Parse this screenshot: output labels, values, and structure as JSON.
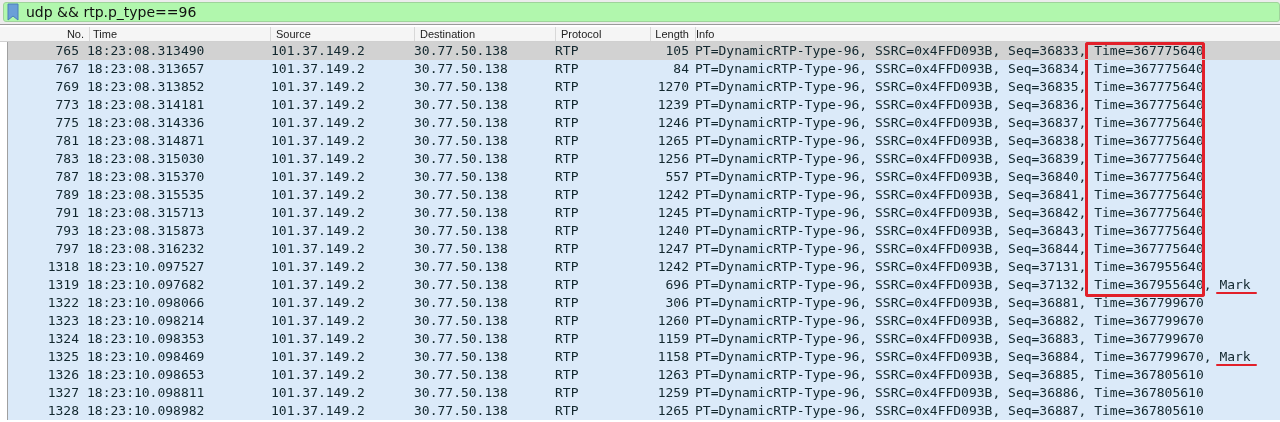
{
  "filter": {
    "value": "udp && rtp.p_type==96"
  },
  "columns": [
    "No.",
    "Time",
    "Source",
    "Destination",
    "Protocol",
    "Length",
    "Info"
  ],
  "rows": [
    {
      "no": "765",
      "time": "18:23:08.313490",
      "source": "101.37.149.2",
      "destination": "30.77.50.138",
      "protocol": "RTP",
      "length": "105",
      "info": "PT=DynamicRTP-Type-96, SSRC=0x4FFD093B, Seq=36833, Time=367775640",
      "selected": true,
      "boxed": true,
      "underlined": false
    },
    {
      "no": "767",
      "time": "18:23:08.313657",
      "source": "101.37.149.2",
      "destination": "30.77.50.138",
      "protocol": "RTP",
      "length": "84",
      "info": "PT=DynamicRTP-Type-96, SSRC=0x4FFD093B, Seq=36834, Time=367775640",
      "selected": false,
      "boxed": true,
      "underlined": false
    },
    {
      "no": "769",
      "time": "18:23:08.313852",
      "source": "101.37.149.2",
      "destination": "30.77.50.138",
      "protocol": "RTP",
      "length": "1270",
      "info": "PT=DynamicRTP-Type-96, SSRC=0x4FFD093B, Seq=36835, Time=367775640",
      "selected": false,
      "boxed": true,
      "underlined": false
    },
    {
      "no": "773",
      "time": "18:23:08.314181",
      "source": "101.37.149.2",
      "destination": "30.77.50.138",
      "protocol": "RTP",
      "length": "1239",
      "info": "PT=DynamicRTP-Type-96, SSRC=0x4FFD093B, Seq=36836, Time=367775640",
      "selected": false,
      "boxed": true,
      "underlined": false
    },
    {
      "no": "775",
      "time": "18:23:08.314336",
      "source": "101.37.149.2",
      "destination": "30.77.50.138",
      "protocol": "RTP",
      "length": "1246",
      "info": "PT=DynamicRTP-Type-96, SSRC=0x4FFD093B, Seq=36837, Time=367775640",
      "selected": false,
      "boxed": true,
      "underlined": false
    },
    {
      "no": "781",
      "time": "18:23:08.314871",
      "source": "101.37.149.2",
      "destination": "30.77.50.138",
      "protocol": "RTP",
      "length": "1265",
      "info": "PT=DynamicRTP-Type-96, SSRC=0x4FFD093B, Seq=36838, Time=367775640",
      "selected": false,
      "boxed": true,
      "underlined": false
    },
    {
      "no": "783",
      "time": "18:23:08.315030",
      "source": "101.37.149.2",
      "destination": "30.77.50.138",
      "protocol": "RTP",
      "length": "1256",
      "info": "PT=DynamicRTP-Type-96, SSRC=0x4FFD093B, Seq=36839, Time=367775640",
      "selected": false,
      "boxed": true,
      "underlined": false
    },
    {
      "no": "787",
      "time": "18:23:08.315370",
      "source": "101.37.149.2",
      "destination": "30.77.50.138",
      "protocol": "RTP",
      "length": "557",
      "info": "PT=DynamicRTP-Type-96, SSRC=0x4FFD093B, Seq=36840, Time=367775640",
      "selected": false,
      "boxed": true,
      "underlined": false
    },
    {
      "no": "789",
      "time": "18:23:08.315535",
      "source": "101.37.149.2",
      "destination": "30.77.50.138",
      "protocol": "RTP",
      "length": "1242",
      "info": "PT=DynamicRTP-Type-96, SSRC=0x4FFD093B, Seq=36841, Time=367775640",
      "selected": false,
      "boxed": true,
      "underlined": false
    },
    {
      "no": "791",
      "time": "18:23:08.315713",
      "source": "101.37.149.2",
      "destination": "30.77.50.138",
      "protocol": "RTP",
      "length": "1245",
      "info": "PT=DynamicRTP-Type-96, SSRC=0x4FFD093B, Seq=36842, Time=367775640",
      "selected": false,
      "boxed": true,
      "underlined": false
    },
    {
      "no": "793",
      "time": "18:23:08.315873",
      "source": "101.37.149.2",
      "destination": "30.77.50.138",
      "protocol": "RTP",
      "length": "1240",
      "info": "PT=DynamicRTP-Type-96, SSRC=0x4FFD093B, Seq=36843, Time=367775640",
      "selected": false,
      "boxed": true,
      "underlined": false
    },
    {
      "no": "797",
      "time": "18:23:08.316232",
      "source": "101.37.149.2",
      "destination": "30.77.50.138",
      "protocol": "RTP",
      "length": "1247",
      "info": "PT=DynamicRTP-Type-96, SSRC=0x4FFD093B, Seq=36844, Time=367775640",
      "selected": false,
      "boxed": true,
      "underlined": false
    },
    {
      "no": "1318",
      "time": "18:23:10.097527",
      "source": "101.37.149.2",
      "destination": "30.77.50.138",
      "protocol": "RTP",
      "length": "1242",
      "info": "PT=DynamicRTP-Type-96, SSRC=0x4FFD093B, Seq=37131, Time=367955640",
      "selected": false,
      "boxed": true,
      "underlined": false
    },
    {
      "no": "1319",
      "time": "18:23:10.097682",
      "source": "101.37.149.2",
      "destination": "30.77.50.138",
      "protocol": "RTP",
      "length": "696",
      "info": "PT=DynamicRTP-Type-96, SSRC=0x4FFD093B, Seq=37132, Time=367955640, Mark",
      "selected": false,
      "boxed": true,
      "underlined": true
    },
    {
      "no": "1322",
      "time": "18:23:10.098066",
      "source": "101.37.149.2",
      "destination": "30.77.50.138",
      "protocol": "RTP",
      "length": "306",
      "info": "PT=DynamicRTP-Type-96, SSRC=0x4FFD093B, Seq=36881, Time=367799670",
      "selected": false,
      "boxed": false,
      "underlined": false
    },
    {
      "no": "1323",
      "time": "18:23:10.098214",
      "source": "101.37.149.2",
      "destination": "30.77.50.138",
      "protocol": "RTP",
      "length": "1260",
      "info": "PT=DynamicRTP-Type-96, SSRC=0x4FFD093B, Seq=36882, Time=367799670",
      "selected": false,
      "boxed": false,
      "underlined": false
    },
    {
      "no": "1324",
      "time": "18:23:10.098353",
      "source": "101.37.149.2",
      "destination": "30.77.50.138",
      "protocol": "RTP",
      "length": "1159",
      "info": "PT=DynamicRTP-Type-96, SSRC=0x4FFD093B, Seq=36883, Time=367799670",
      "selected": false,
      "boxed": false,
      "underlined": false
    },
    {
      "no": "1325",
      "time": "18:23:10.098469",
      "source": "101.37.149.2",
      "destination": "30.77.50.138",
      "protocol": "RTP",
      "length": "1158",
      "info": "PT=DynamicRTP-Type-96, SSRC=0x4FFD093B, Seq=36884, Time=367799670, Mark",
      "selected": false,
      "boxed": false,
      "underlined": true
    },
    {
      "no": "1326",
      "time": "18:23:10.098653",
      "source": "101.37.149.2",
      "destination": "30.77.50.138",
      "protocol": "RTP",
      "length": "1263",
      "info": "PT=DynamicRTP-Type-96, SSRC=0x4FFD093B, Seq=36885, Time=367805610",
      "selected": false,
      "boxed": false,
      "underlined": false
    },
    {
      "no": "1327",
      "time": "18:23:10.098811",
      "source": "101.37.149.2",
      "destination": "30.77.50.138",
      "protocol": "RTP",
      "length": "1259",
      "info": "PT=DynamicRTP-Type-96, SSRC=0x4FFD093B, Seq=36886, Time=367805610",
      "selected": false,
      "boxed": false,
      "underlined": false
    },
    {
      "no": "1328",
      "time": "18:23:10.098982",
      "source": "101.37.149.2",
      "destination": "30.77.50.138",
      "protocol": "RTP",
      "length": "1265",
      "info": "PT=DynamicRTP-Type-96, SSRC=0x4FFD093B, Seq=36887, Time=367805610",
      "selected": false,
      "boxed": false,
      "underlined": false
    }
  ]
}
